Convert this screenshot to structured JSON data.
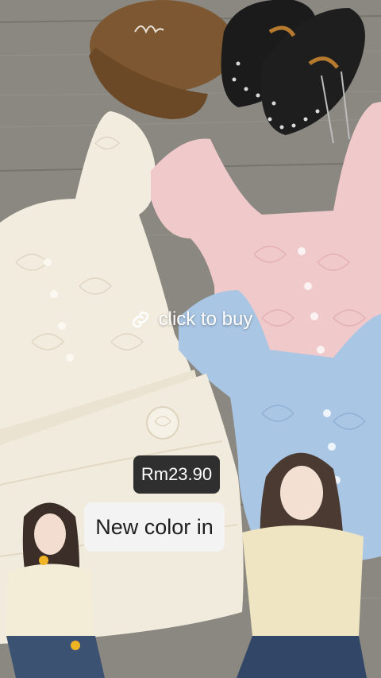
{
  "overlay": {
    "link_icon": "link-icon",
    "link_label": "click to buy",
    "price": "Rm23.90",
    "caption": "New color in"
  },
  "colors": {
    "floor": "#8e8b86",
    "cream_top": "#f2ecdf",
    "pink_top": "#f0c9cb",
    "blue_top": "#a9c6e4",
    "skirt": "#f1ebdd",
    "cap": "#7a5530",
    "shoes": "#1d1d1d",
    "price_bg": "#2f2f2f",
    "caption_bg": "#f3f3f3"
  }
}
